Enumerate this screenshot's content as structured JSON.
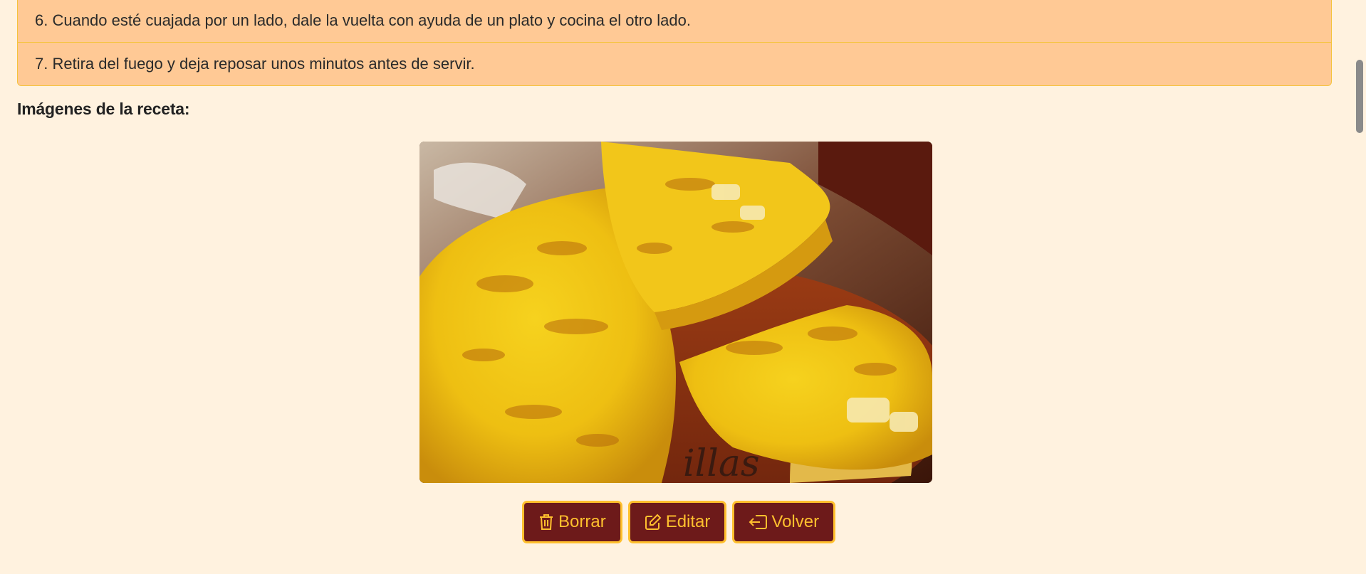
{
  "steps": [
    "6. Cuando esté cuajada por un lado, dale la vuelta con ayuda de un plato y cocina el otro lado.",
    "7. Retira del fuego y deja reposar unos minutos antes de servir."
  ],
  "images_section": {
    "title": "Imágenes de la receta:"
  },
  "actions": {
    "delete_label": "Borrar",
    "edit_label": "Editar",
    "back_label": "Volver"
  },
  "theme": {
    "background": "#fff2df",
    "steps_background": "#ffc995",
    "accent": "#ffc02e",
    "button_background": "#6d1a1a"
  },
  "icons": {
    "delete": "trash-icon",
    "edit": "edit-icon",
    "back": "back-arrow-icon"
  }
}
